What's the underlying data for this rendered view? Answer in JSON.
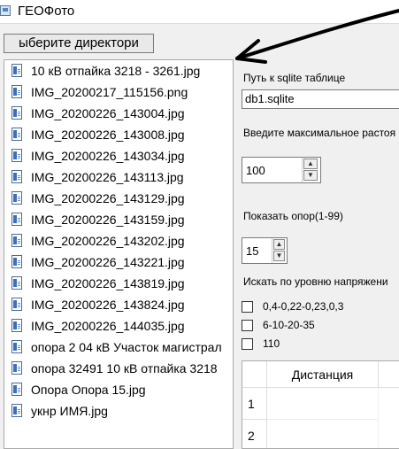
{
  "window": {
    "title": "ГЕОФото"
  },
  "dir_button": {
    "label": "ыберите директори"
  },
  "files": [
    "10 кВ отпайка 3218 - 3261.jpg",
    "IMG_20200217_115156.png",
    "IMG_20200226_143004.jpg",
    "IMG_20200226_143008.jpg",
    "IMG_20200226_143034.jpg",
    "IMG_20200226_143113.jpg",
    "IMG_20200226_143129.jpg",
    "IMG_20200226_143159.jpg",
    "IMG_20200226_143202.jpg",
    "IMG_20200226_143221.jpg",
    "IMG_20200226_143819.jpg",
    "IMG_20200226_143824.jpg",
    "IMG_20200226_144035.jpg",
    "опора 2 04 кВ Участок магистрал",
    "опора 32491 10 кВ отпайка 3218",
    "Опора Опора 15.jpg",
    "укнр ИМЯ.jpg"
  ],
  "settings": {
    "sqlite_label": "Путь к sqlite таблице",
    "sqlite_value": "db1.sqlite",
    "distance_label": "Введите максимальное растоя",
    "distance_value": "100",
    "supports_label": "Показать опор(1-99)",
    "supports_value": "15",
    "voltage_label": "Искать по уровню напряжени",
    "voltage_options": [
      "0,4-0,22-0,23,0,3",
      "6-10-20-35",
      "110"
    ]
  },
  "table": {
    "column_header": "Дистанция",
    "row_headers": [
      "1",
      "2"
    ]
  }
}
